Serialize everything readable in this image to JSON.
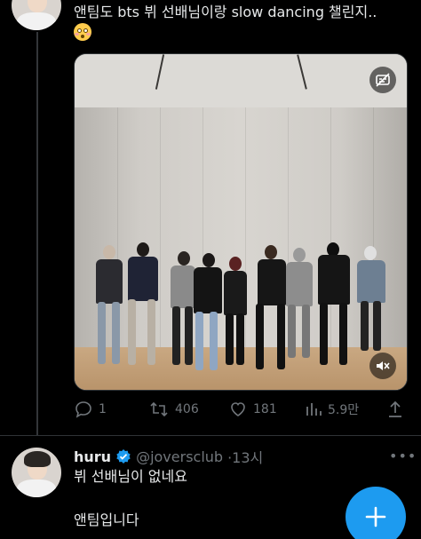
{
  "tweet1": {
    "text": "앤팀도 bts 뷔 선배님이랑 slow dancing 챌린지..",
    "emoji": "flushed-face-emoji",
    "stats": {
      "replies": "1",
      "retweets": "406",
      "likes": "181",
      "views": "5.9만"
    }
  },
  "tweet2": {
    "name": "huru",
    "handle": "@joversclub",
    "time": "·13시",
    "line1": "뷔 선배님이 없네요",
    "line2": "앤팀입니다"
  },
  "colors": {
    "background": "#000000",
    "text": "#e7e9ea",
    "muted": "#71767b",
    "accent": "#1d9bf0"
  },
  "icons": {
    "reply": "reply-icon",
    "retweet": "retweet-icon",
    "like": "heart-icon",
    "views": "views-icon",
    "share": "share-icon",
    "verified": "verified-badge-icon",
    "captions": "captions-off-icon",
    "mute": "mute-icon",
    "compose": "compose-plus-icon"
  }
}
